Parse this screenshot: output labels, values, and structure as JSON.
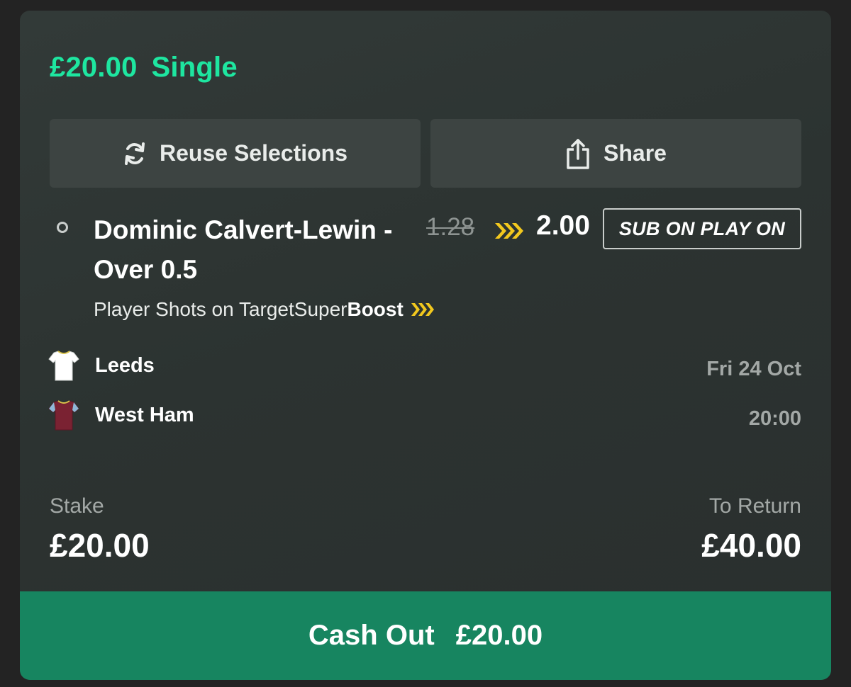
{
  "bet": {
    "stake_header": "£20.00",
    "type": "Single"
  },
  "actions": {
    "reuse_label": "Reuse Selections",
    "share_label": "Share"
  },
  "selection": {
    "name": "Dominic Calvert-Lewin - Over 0.5",
    "old_odds": "1.28",
    "new_odds": "2.00",
    "badge": "SUB ON PLAY ON",
    "market": "Player Shots on Target",
    "boost_prefix": "Super ",
    "boost_label": "Boost"
  },
  "event": {
    "home_team": "Leeds",
    "away_team": "West Ham",
    "date": "Fri 24 Oct",
    "time": "20:00"
  },
  "summary": {
    "stake_label": "Stake",
    "stake_value": "£20.00",
    "return_label": "To Return",
    "return_value": "£40.00"
  },
  "cashout": {
    "label": "Cash Out",
    "amount": "£20.00"
  },
  "colors": {
    "accent_green": "#1ee6a0",
    "cashout_green": "#178560",
    "boost_yellow": "#f2c81e",
    "card_bg": "#2e3533",
    "home_shirt": "#ffffff",
    "away_shirt": "#7a2232"
  },
  "icons": {
    "reuse": "refresh-icon",
    "share": "share-icon",
    "boost": "boost-chevrons-icon",
    "home_team": "white-shirt-icon",
    "away_team": "claret-shirt-icon"
  }
}
